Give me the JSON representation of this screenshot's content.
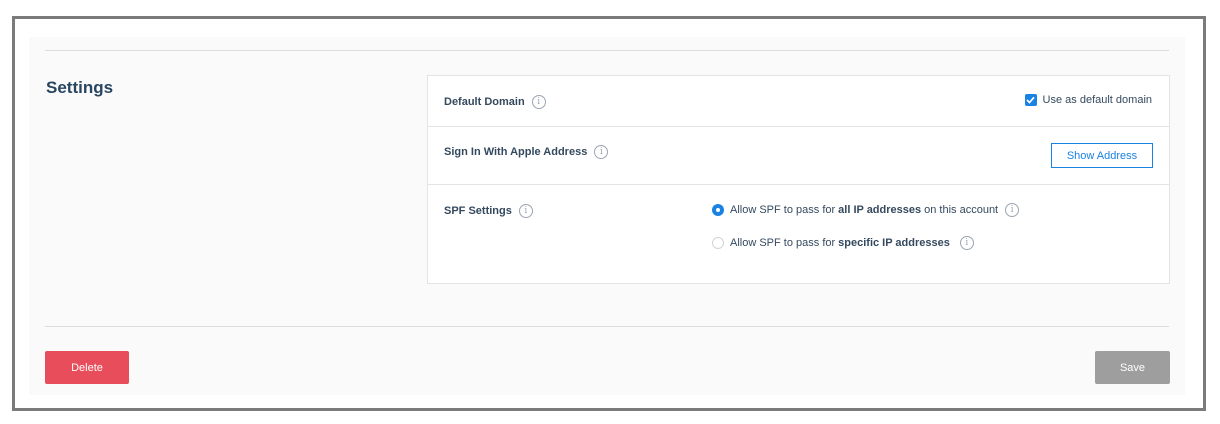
{
  "section": {
    "title": "Settings"
  },
  "default_domain": {
    "label": "Default Domain",
    "checkbox_label": "Use as default domain",
    "checked": true
  },
  "apple_address": {
    "label": "Sign In With Apple Address",
    "button_label": "Show Address"
  },
  "spf": {
    "label": "SPF Settings",
    "option_all": {
      "prefix": "Allow SPF to pass for",
      "bold": "all IP addresses",
      "suffix": "on this account",
      "selected": true
    },
    "option_specific": {
      "prefix": "Allow SPF to pass for",
      "bold": "specific IP addresses",
      "selected": false
    }
  },
  "actions": {
    "delete_label": "Delete",
    "save_label": "Save"
  },
  "colors": {
    "accent": "#1a82e2",
    "danger": "#e84d5b",
    "disabled": "#9e9e9e"
  }
}
